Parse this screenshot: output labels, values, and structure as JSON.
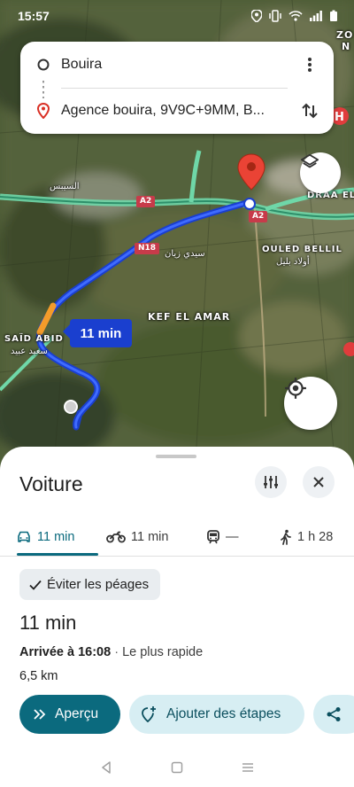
{
  "status_bar": {
    "time": "15:57"
  },
  "directions": {
    "origin": "Bouira",
    "destination": "Agence bouira, 9V9C+9MM, B..."
  },
  "map": {
    "labels": {
      "kef_el_amar": "KEF EL AMAR",
      "ouled_bellil": "OULED BELLIL",
      "ouled_bellil_ar": "أولاد بليل",
      "said_abid": "SAÏD ABID",
      "said_abid_ar": "سعيد عبيد",
      "draa": "DRAA EL B",
      "arabic_left": "السيبس",
      "arabic_mid": "سيدي زيان",
      "top_right": "ZO",
      "top_right2": "N"
    },
    "shields": {
      "a2_left": "A2",
      "a2_right": "A2",
      "n18": "N18"
    },
    "duration_chip": "11 min",
    "icons": {
      "layers": "layers-icon",
      "locate": "my-location-icon"
    }
  },
  "sheet": {
    "title": "Voiture",
    "modes": [
      {
        "label": "11 min",
        "icon": "car-icon"
      },
      {
        "label": "11 min",
        "icon": "motorcycle-icon"
      },
      {
        "label": "—",
        "icon": "train-icon"
      },
      {
        "label": "1 h 28",
        "icon": "walk-icon"
      }
    ],
    "toll_chip": "Éviter les péages",
    "route": {
      "duration": "11 min",
      "arrival": "Arrivée à 16:08",
      "note": "Le plus rapide",
      "distance": "6,5 km"
    },
    "actions": {
      "preview": "Aperçu",
      "add_stops": "Ajouter des étapes"
    }
  },
  "colors": {
    "accent": "#0b6a7e",
    "route": "#1a3fcf",
    "chip_bg": "#d7eef3"
  }
}
